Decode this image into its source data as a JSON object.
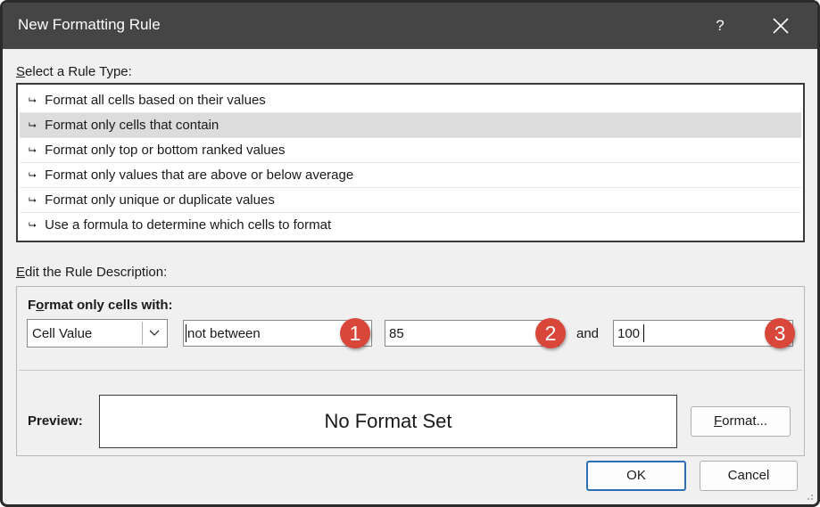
{
  "window": {
    "title": "New Formatting Rule",
    "help_label": "?",
    "close_icon": "close-icon"
  },
  "rule_type": {
    "label_accel": "S",
    "label_rest": "elect a Rule Type:",
    "items": [
      {
        "label": "Format all cells based on their values"
      },
      {
        "label": "Format only cells that contain"
      },
      {
        "label": "Format only top or bottom ranked values"
      },
      {
        "label": "Format only values that are above or below average"
      },
      {
        "label": "Format only unique or duplicate values"
      },
      {
        "label": "Use a formula to determine which cells to format"
      }
    ],
    "selected_index": 1,
    "item_icon": "arrow-right-icon"
  },
  "description": {
    "label_accel": "E",
    "label_rest": "dit the Rule Description:",
    "heading_pre": "F",
    "heading_accel": "o",
    "heading_rest": "rmat only cells with:",
    "cell_value_select": "Cell Value",
    "operator_value": "not between",
    "value1": "85",
    "and_label": "and",
    "value2": "100",
    "badges": [
      "1",
      "2",
      "3"
    ],
    "badge_color": "#d9473b"
  },
  "preview": {
    "label": "Preview:",
    "text": "No Format Set",
    "format_button_accel": "F",
    "format_button_rest": "ormat..."
  },
  "buttons": {
    "ok": "OK",
    "cancel": "Cancel"
  },
  "colors": {
    "titlebar": "#454545",
    "dialog_bg": "#f0f0f0",
    "selected_row": "#dcdcdc",
    "ok_border": "#2f6fb5"
  }
}
